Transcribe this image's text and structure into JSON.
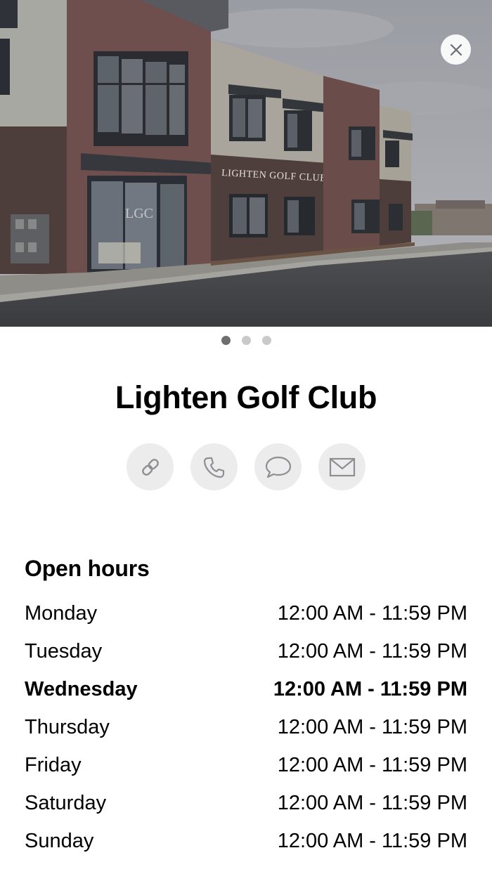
{
  "place": {
    "name": "Lighten Golf Club",
    "sign_text": "LIGHTEN GOLF CLUB",
    "door_logo": "LGC"
  },
  "gallery": {
    "page_count": 3,
    "active_index": 0
  },
  "actions": [
    {
      "icon": "link-icon"
    },
    {
      "icon": "phone-icon"
    },
    {
      "icon": "message-icon"
    },
    {
      "icon": "mail-icon"
    }
  ],
  "hours": {
    "heading": "Open hours",
    "days": [
      {
        "day": "Monday",
        "time": "12:00 AM - 11:59 PM"
      },
      {
        "day": "Tuesday",
        "time": "12:00 AM - 11:59 PM"
      },
      {
        "day": "Wednesday",
        "time": "12:00 AM - 11:59 PM"
      },
      {
        "day": "Thursday",
        "time": "12:00 AM - 11:59 PM"
      },
      {
        "day": "Friday",
        "time": "12:00 AM - 11:59 PM"
      },
      {
        "day": "Saturday",
        "time": "12:00 AM - 11:59 PM"
      },
      {
        "day": "Sunday",
        "time": "12:00 AM - 11:59 PM"
      }
    ],
    "today": "Wednesday"
  },
  "colors": {
    "button_bg": "#ececec",
    "icon_stroke": "#8e8e93",
    "dot_active": "#6e6e6e",
    "dot_inactive": "#c9c9c9"
  }
}
